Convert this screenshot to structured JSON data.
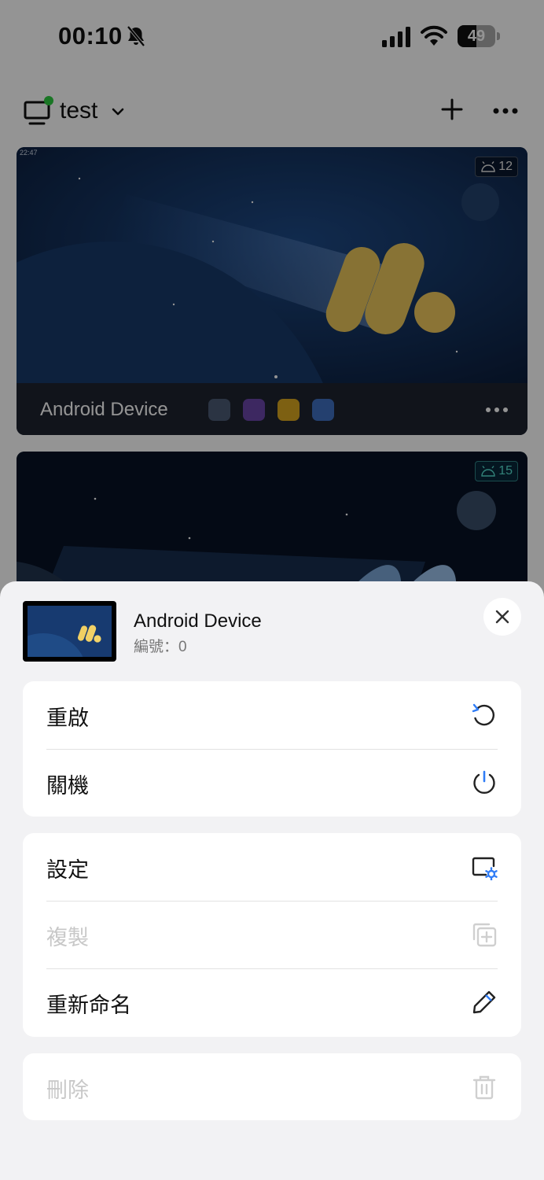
{
  "status_bar": {
    "time": "00:10",
    "battery_level": "49",
    "battery_fraction": 0.49
  },
  "header": {
    "group_name": "test",
    "online_color": "#2ecc40"
  },
  "device_cards": [
    {
      "name": "Android Device",
      "android_version": "12",
      "mini_time": "22:47"
    },
    {
      "android_version": "15"
    }
  ],
  "sheet": {
    "device_name": "Android Device",
    "device_number": "編號：0",
    "groups": [
      [
        {
          "label": "重啟",
          "icon": "restart-icon",
          "enabled": true
        },
        {
          "label": "關機",
          "icon": "power-icon",
          "enabled": true
        }
      ],
      [
        {
          "label": "設定",
          "icon": "settings-window-icon",
          "enabled": true
        },
        {
          "label": "複製",
          "icon": "duplicate-icon",
          "enabled": false
        },
        {
          "label": "重新命名",
          "icon": "edit-pencil-icon",
          "enabled": true
        }
      ],
      [
        {
          "label": "刪除",
          "icon": "trash-icon",
          "enabled": false
        }
      ]
    ],
    "accent_color": "#2f7cf6"
  }
}
